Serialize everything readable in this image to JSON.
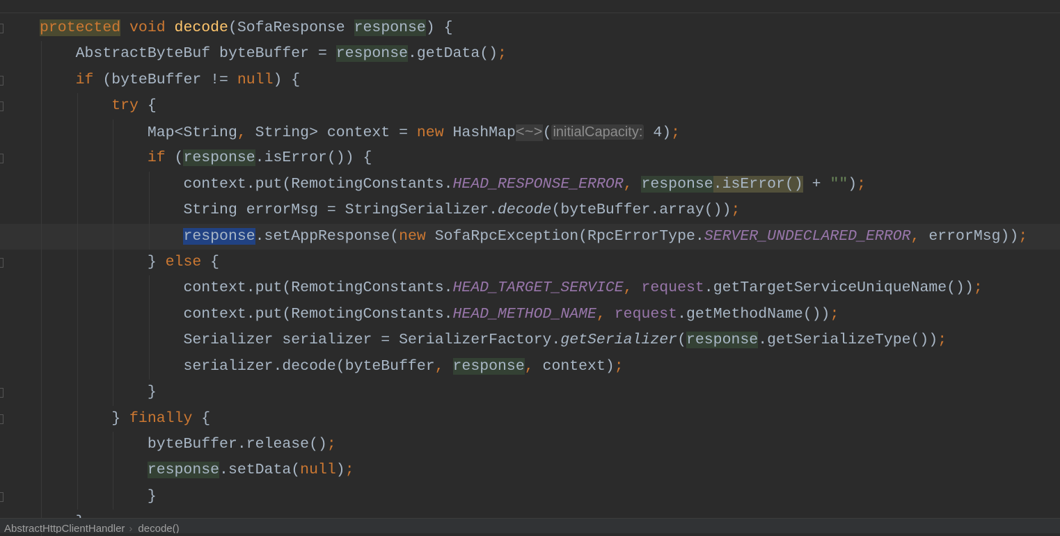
{
  "editor": {
    "current_line": 8,
    "colors": {
      "background": "#2b2b2b",
      "keyword": "#cc7832",
      "method": "#ffc66d",
      "text": "#a9b7c6",
      "constant": "#9876aa",
      "string": "#6a8759",
      "usage_highlight": "#344134",
      "selection": "#214283"
    },
    "gutter_icon": "lightbulb-icon",
    "lines": [
      {
        "indent": 0,
        "tokens": [
          [
            "protected",
            "kw phl"
          ],
          [
            " "
          ],
          [
            "void",
            "kw"
          ],
          [
            " "
          ],
          [
            "decode",
            "fn"
          ],
          [
            "(SofaResponse "
          ],
          [
            "response",
            "hl"
          ],
          [
            ") {"
          ]
        ]
      },
      {
        "indent": 1,
        "tokens": [
          [
            "AbstractByteBuf byteBuffer = "
          ],
          [
            "response",
            "hl"
          ],
          [
            ".getData()"
          ],
          [
            ";",
            "kw"
          ]
        ]
      },
      {
        "indent": 1,
        "tokens": [
          [
            "if",
            "kw"
          ],
          [
            " (byteBuffer != "
          ],
          [
            "null",
            "kw"
          ],
          [
            ") {"
          ]
        ]
      },
      {
        "indent": 2,
        "tokens": [
          [
            "try",
            "kw"
          ],
          [
            " {"
          ]
        ]
      },
      {
        "indent": 3,
        "tokens": [
          [
            "Map<String"
          ],
          [
            ",",
            "kw"
          ],
          [
            " String> context = "
          ],
          [
            "new",
            "kw"
          ],
          [
            " HashMap"
          ],
          [
            "<~>",
            "tmpl"
          ],
          [
            "("
          ],
          [
            "initialCapacity:",
            "hint"
          ],
          [
            " 4)"
          ],
          [
            ";",
            "kw"
          ]
        ]
      },
      {
        "indent": 3,
        "tokens": [
          [
            "if",
            "kw"
          ],
          [
            " ("
          ],
          [
            "response",
            "hl"
          ],
          [
            ".isError()) {"
          ]
        ]
      },
      {
        "indent": 4,
        "tokens": [
          [
            "context.put(RemotingConstants."
          ],
          [
            "HEAD_RESPONSE_ERROR",
            "cst"
          ],
          [
            ",",
            "kw"
          ],
          [
            " "
          ],
          [
            "response",
            "hl"
          ],
          [
            ".isError()",
            "yhl"
          ],
          [
            " + "
          ],
          [
            "\"\"",
            "str"
          ],
          [
            ")"
          ],
          [
            ";",
            "kw"
          ]
        ]
      },
      {
        "indent": 4,
        "tokens": [
          [
            "String errorMsg = StringSerializer."
          ],
          [
            "decode",
            "it"
          ],
          [
            "(byteBuffer.array())"
          ],
          [
            ";",
            "kw"
          ]
        ]
      },
      {
        "indent": 4,
        "tokens": [
          [
            "response",
            "sel"
          ],
          [
            ".setAppResponse("
          ],
          [
            "new",
            "kw"
          ],
          [
            " SofaRpcException(RpcErrorType."
          ],
          [
            "SERVER_UNDECLARED_ERROR",
            "cst"
          ],
          [
            ",",
            "kw"
          ],
          [
            " errorMsg))"
          ],
          [
            ";",
            "kw"
          ]
        ]
      },
      {
        "indent": 3,
        "tokens": [
          [
            "} "
          ],
          [
            "else",
            "kw"
          ],
          [
            " {"
          ]
        ]
      },
      {
        "indent": 4,
        "tokens": [
          [
            "context.put(RemotingConstants."
          ],
          [
            "HEAD_TARGET_SERVICE",
            "cst"
          ],
          [
            ",",
            "kw"
          ],
          [
            " "
          ],
          [
            "request",
            "fld"
          ],
          [
            ".getTargetServiceUniqueName())"
          ],
          [
            ";",
            "kw"
          ]
        ]
      },
      {
        "indent": 4,
        "tokens": [
          [
            "context.put(RemotingConstants."
          ],
          [
            "HEAD_METHOD_NAME",
            "cst"
          ],
          [
            ",",
            "kw"
          ],
          [
            " "
          ],
          [
            "request",
            "fld"
          ],
          [
            ".getMethodName())"
          ],
          [
            ";",
            "kw"
          ]
        ]
      },
      {
        "indent": 4,
        "tokens": [
          [
            "Serializer serializer = SerializerFactory."
          ],
          [
            "getSerializer",
            "it"
          ],
          [
            "("
          ],
          [
            "response",
            "hl"
          ],
          [
            ".getSerializeType())"
          ],
          [
            ";",
            "kw"
          ]
        ]
      },
      {
        "indent": 4,
        "tokens": [
          [
            "serializer.decode(byteBuffer"
          ],
          [
            ",",
            "kw"
          ],
          [
            " "
          ],
          [
            "response",
            "hl"
          ],
          [
            ",",
            "kw"
          ],
          [
            " context)"
          ],
          [
            ";",
            "kw"
          ]
        ]
      },
      {
        "indent": 3,
        "tokens": [
          [
            "}"
          ]
        ]
      },
      {
        "indent": 2,
        "tokens": [
          [
            "} "
          ],
          [
            "finally",
            "kw"
          ],
          [
            " {"
          ]
        ]
      },
      {
        "indent": 3,
        "tokens": [
          [
            "byteBuffer.release()"
          ],
          [
            ";",
            "kw"
          ]
        ]
      },
      {
        "indent": 3,
        "tokens": [
          [
            "response",
            "hl"
          ],
          [
            ".setData("
          ],
          [
            "null",
            "kw"
          ],
          [
            ")"
          ],
          [
            ";",
            "kw"
          ]
        ]
      },
      {
        "indent": 3,
        "tokens": [
          [
            "}"
          ]
        ]
      },
      {
        "indent": 1,
        "tokens": [
          [
            "}"
          ]
        ]
      }
    ]
  },
  "breadcrumb": {
    "items": [
      "AbstractHttpClientHandler",
      "decode()"
    ]
  }
}
